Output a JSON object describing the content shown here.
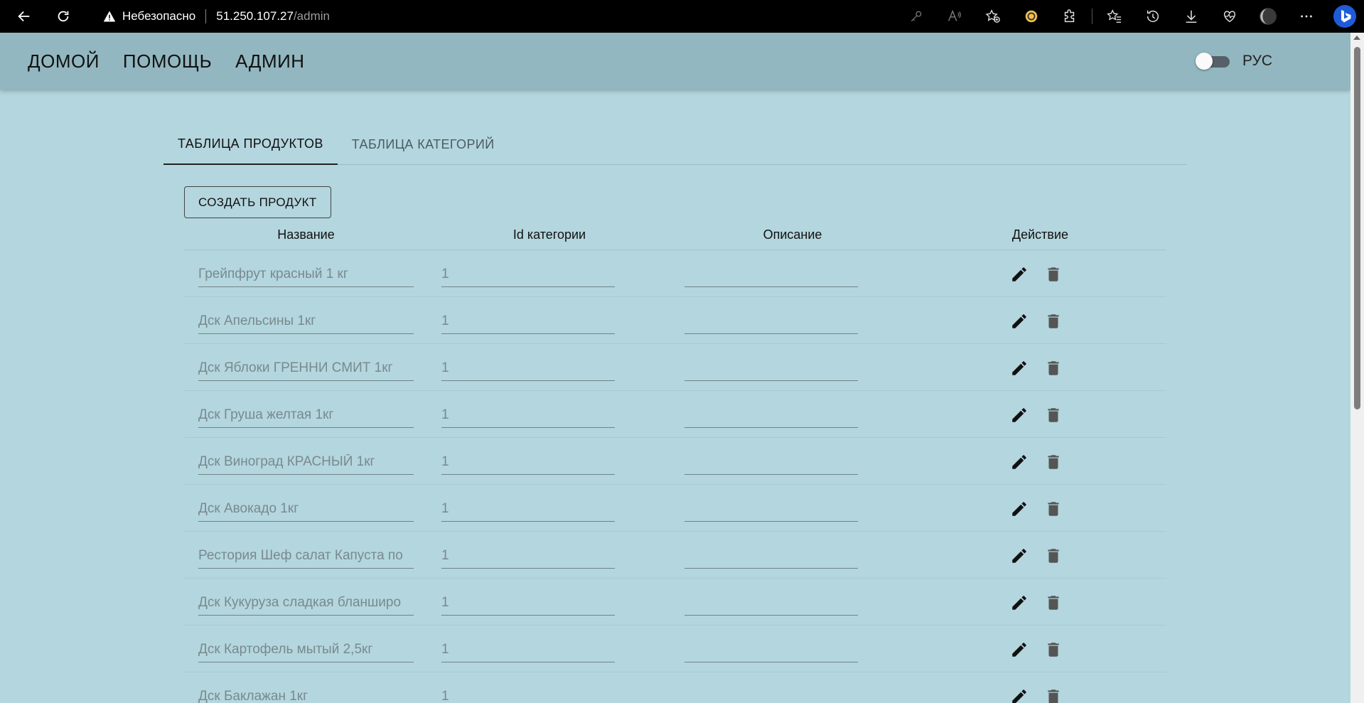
{
  "browser": {
    "security_label": "Небезопасно",
    "url_host": "51.250.107.27",
    "url_path": "/admin"
  },
  "nav": {
    "home": "ДОМОЙ",
    "help": "ПОМОЩЬ",
    "admin": "АДМИН",
    "lang_label": "РУС"
  },
  "tabs": {
    "products": "ТАБЛИЦА ПРОДУКТОВ",
    "categories": "ТАБЛИЦА КАТЕГОРИЙ"
  },
  "create_button": "СОЗДАТЬ ПРОДУКТ",
  "table": {
    "headers": [
      "Название",
      "Id категории",
      "Описание",
      "Действие"
    ],
    "rows": [
      {
        "name": "Грейпфрут красный 1 кг",
        "category_id": "1",
        "description": ""
      },
      {
        "name": "Дск Апельсины 1кг",
        "category_id": "1",
        "description": ""
      },
      {
        "name": "Дск Яблоки ГРЕННИ СМИТ 1кг",
        "category_id": "1",
        "description": ""
      },
      {
        "name": "Дск Груша желтая 1кг",
        "category_id": "1",
        "description": ""
      },
      {
        "name": "Дск Виноград КРАСНЫЙ 1кг",
        "category_id": "1",
        "description": ""
      },
      {
        "name": "Дск Авокадо 1кг",
        "category_id": "1",
        "description": ""
      },
      {
        "name": "Рестория Шеф салат Капуста по",
        "category_id": "1",
        "description": ""
      },
      {
        "name": "Дск Кукуруза сладкая бланширо",
        "category_id": "1",
        "description": ""
      },
      {
        "name": "Дск Картофель мытый 2,5кг",
        "category_id": "1",
        "description": ""
      },
      {
        "name": "Дск Баклажан 1кг",
        "category_id": "1",
        "description": ""
      }
    ]
  }
}
